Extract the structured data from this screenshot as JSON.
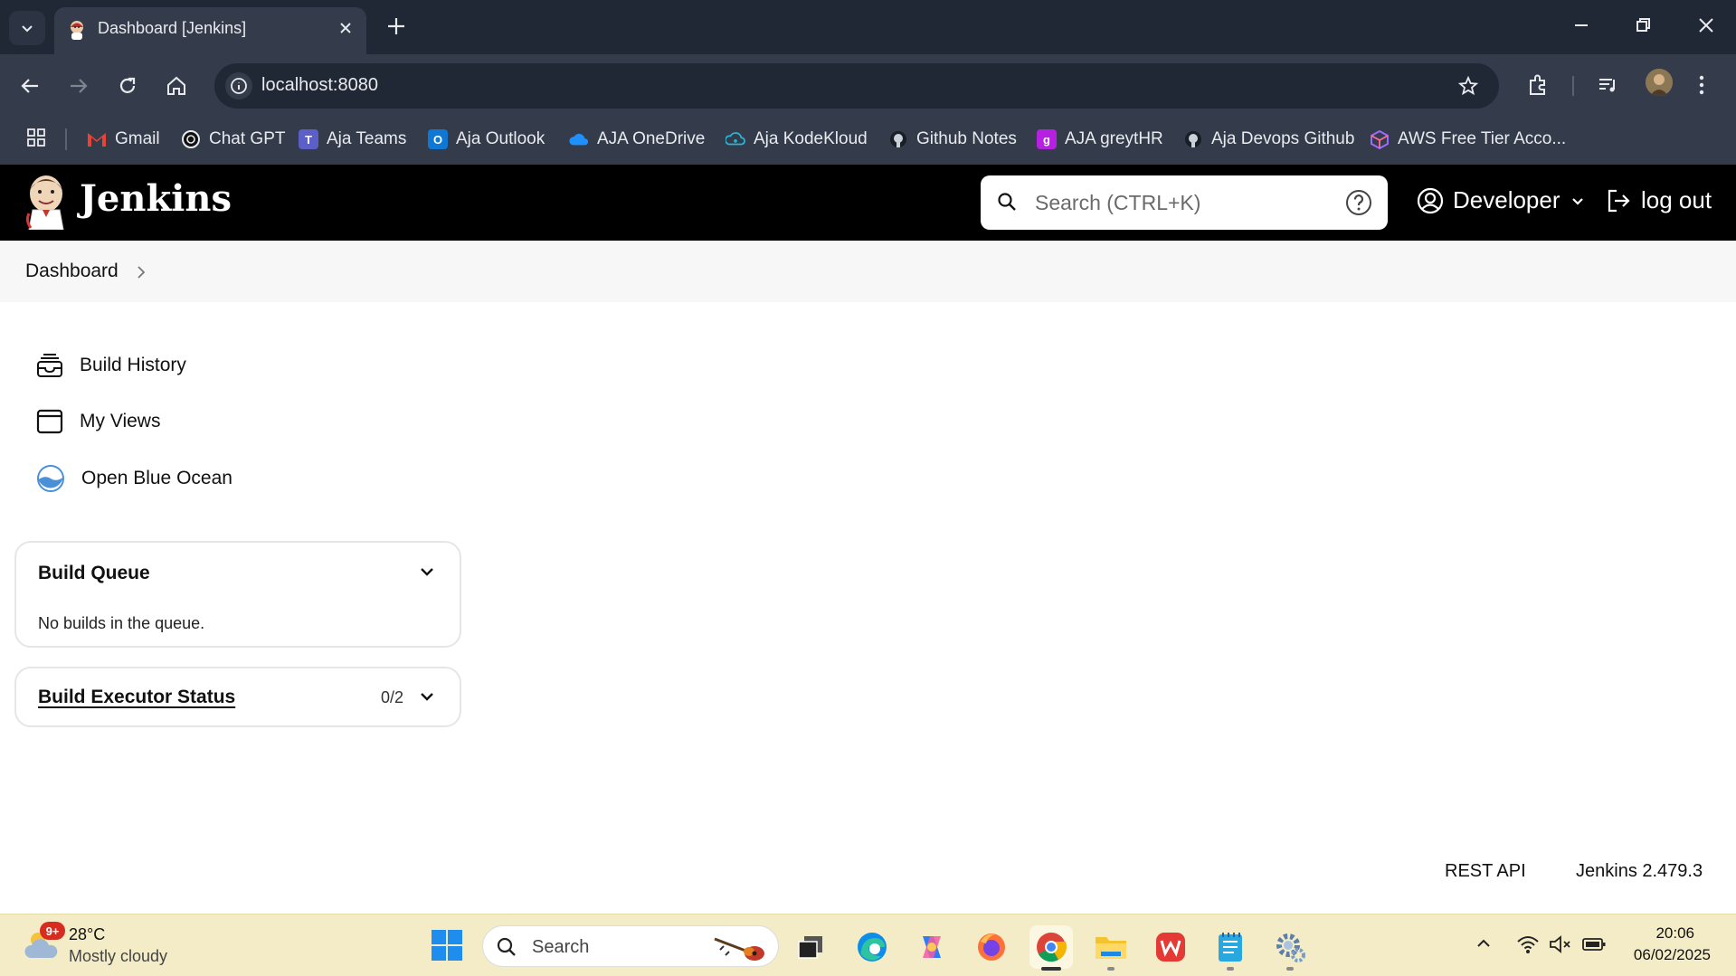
{
  "browser": {
    "tab_title": "Dashboard [Jenkins]",
    "url": "localhost:8080",
    "bookmarks": [
      {
        "label": "Gmail",
        "icon": "gmail-icon",
        "color": "#ea4335"
      },
      {
        "label": "Chat GPT",
        "icon": "chatgpt-icon",
        "color": "#ffffff"
      },
      {
        "label": "Aja Teams",
        "icon": "teams-icon",
        "color": "#5b5fc7"
      },
      {
        "label": "Aja Outlook",
        "icon": "outlook-icon",
        "color": "#0f78d4"
      },
      {
        "label": "AJA OneDrive",
        "icon": "onedrive-icon",
        "color": "#1e90ff"
      },
      {
        "label": "Aja KodeKloud",
        "icon": "kodekloud-icon",
        "color": "#2bb3d1"
      },
      {
        "label": "Github Notes",
        "icon": "github-icon",
        "color": "#c9d1d9"
      },
      {
        "label": "AJA greytHR",
        "icon": "greythr-icon",
        "color": "#b620e0"
      },
      {
        "label": "Aja Devops Github",
        "icon": "github-icon",
        "color": "#c9d1d9"
      },
      {
        "label": "AWS Free Tier Acco...",
        "icon": "aws-cube-icon",
        "color": "#9b6bff"
      }
    ]
  },
  "jenkins": {
    "title": "Jenkins",
    "search_placeholder": "Search (CTRL+K)",
    "user": "Developer",
    "logout": "log out",
    "breadcrumb": "Dashboard",
    "tasks": [
      {
        "label": "Build History",
        "icon": "build-history-icon"
      },
      {
        "label": "My Views",
        "icon": "my-views-icon"
      },
      {
        "label": "Open Blue Ocean",
        "icon": "blue-ocean-icon"
      }
    ],
    "build_queue": {
      "title": "Build Queue",
      "empty_text": "No builds in the queue."
    },
    "executor_status": {
      "title": "Build Executor Status",
      "count": "0/2"
    },
    "footer": {
      "rest_api": "REST API",
      "version": "Jenkins 2.479.3"
    }
  },
  "taskbar": {
    "weather_badge": "9+",
    "temperature": "28°C",
    "weather": "Mostly cloudy",
    "search_label": "Search",
    "time": "20:06",
    "date": "06/02/2025"
  },
  "colors": {
    "jenkins_header": "#000000",
    "browser_chrome": "#343c4c",
    "tabstrip": "#202735",
    "taskbar": "#f3ecc6"
  }
}
